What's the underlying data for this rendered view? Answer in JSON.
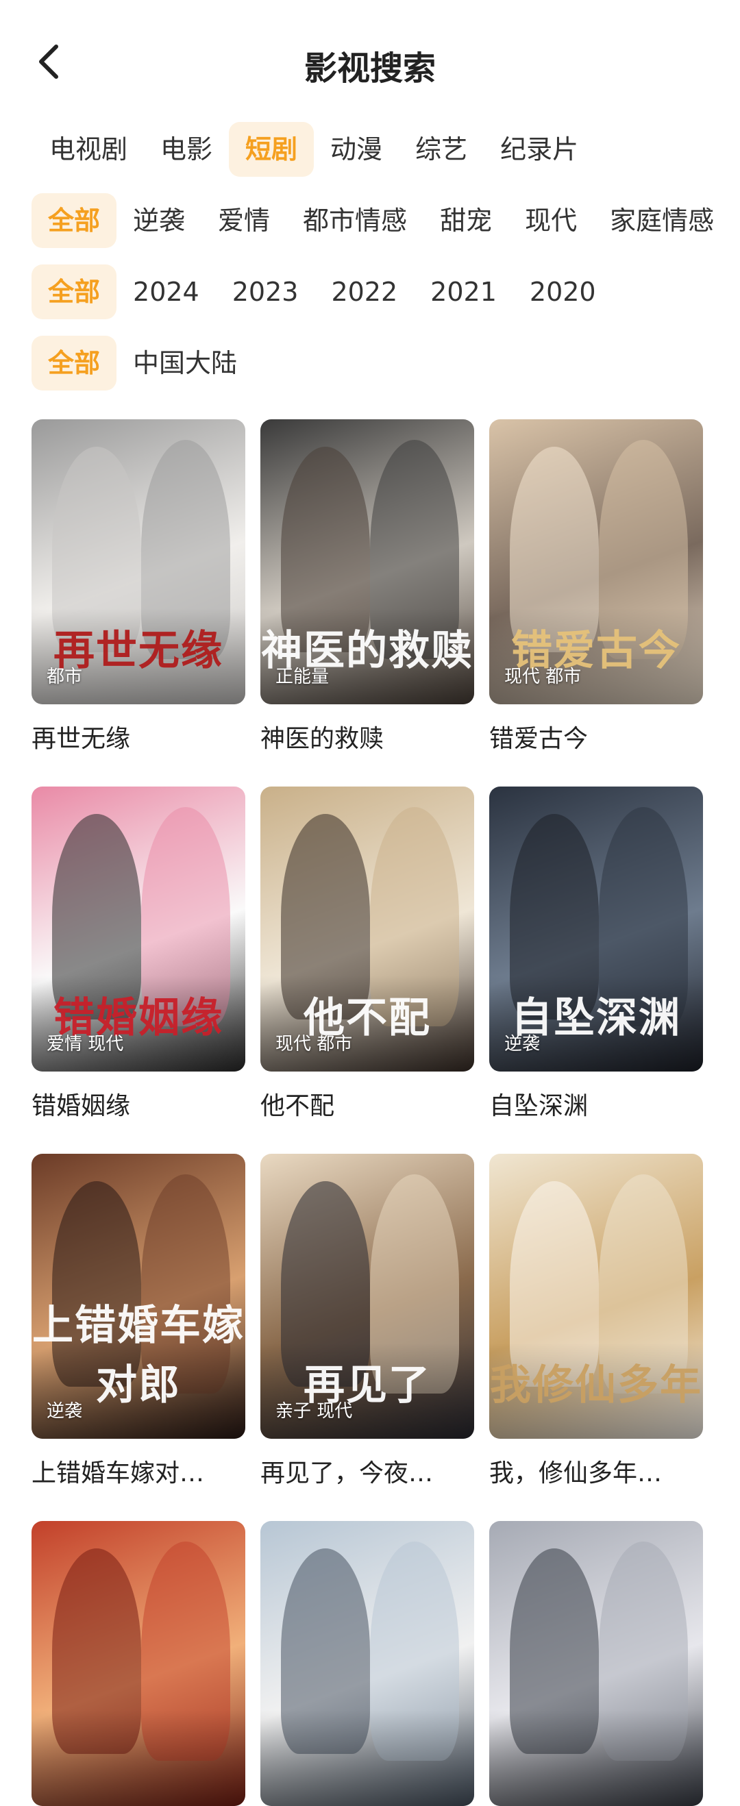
{
  "header": {
    "title": "影视搜索"
  },
  "filters": {
    "types": [
      "电视剧",
      "电影",
      "短剧",
      "动漫",
      "综艺",
      "纪录片"
    ],
    "genres": [
      "全部",
      "逆袭",
      "爱情",
      "都市情感",
      "甜宠",
      "现代",
      "家庭情感"
    ],
    "years": [
      "全部",
      "2024",
      "2023",
      "2022",
      "2021",
      "2020"
    ],
    "regions": [
      "全部",
      "中国大陆"
    ],
    "active_type": "短剧",
    "active_genre": "全部",
    "active_year": "全部",
    "active_region": "全部"
  },
  "items": [
    {
      "title": "再世无缘",
      "tag": "都市",
      "poster_art": "再世无缘",
      "colors": [
        "#9a9a9a",
        "#f1efec",
        "#c8c6c4"
      ],
      "art_color": "#b01d1d"
    },
    {
      "title": "神医的救赎",
      "tag": "正能量",
      "poster_art": "神医的救赎",
      "colors": [
        "#3a3a3a",
        "#cfc9c0",
        "#4a4038"
      ],
      "art_color": "#ffffff"
    },
    {
      "title": "错爱古今",
      "tag": "现代 都市",
      "poster_art": "错爱古今",
      "colors": [
        "#d9c3a8",
        "#7a6a5e",
        "#f3e4d0"
      ],
      "art_color": "#e6c27a"
    },
    {
      "title": "错婚姻缘",
      "tag": "爱情 现代",
      "poster_art": "错婚姻缘",
      "colors": [
        "#e98aa6",
        "#fafafa",
        "#2c2c2c"
      ],
      "art_color": "#c8202a"
    },
    {
      "title": "他不配",
      "tag": "现代 都市",
      "poster_art": "他不配",
      "colors": [
        "#c9b089",
        "#efe6d6",
        "#3b2f28"
      ],
      "art_color": "#ffffff"
    },
    {
      "title": "自坠深渊",
      "tag": "逆袭",
      "poster_art": "自坠深渊",
      "colors": [
        "#2b3340",
        "#6e7c8e",
        "#1d2028"
      ],
      "art_color": "#ffffff"
    },
    {
      "title": "上错婚车嫁对…",
      "tag": "逆袭",
      "poster_art": "上错婚车嫁对郎",
      "colors": [
        "#6b3b27",
        "#d8a070",
        "#2a1a16"
      ],
      "art_color": "#ffffff"
    },
    {
      "title": "再见了，今夜…",
      "tag": "亲子 现代",
      "poster_art": "再见了",
      "colors": [
        "#e9d9c2",
        "#8a6a4c",
        "#2a2a32"
      ],
      "art_color": "#ffffff"
    },
    {
      "title": "我，修仙多年…",
      "tag": "",
      "poster_art": "我修仙多年",
      "colors": [
        "#f0e6d2",
        "#c9a062",
        "#fbf6ee"
      ],
      "art_color": "#c9a062"
    },
    {
      "title": "",
      "tag": "",
      "poster_art": "",
      "colors": [
        "#c2402a",
        "#f1b07a",
        "#7a1f14"
      ],
      "art_color": "#ffffff"
    },
    {
      "title": "",
      "tag": "",
      "poster_art": "",
      "colors": [
        "#b7c6d4",
        "#f1f1f1",
        "#4a5664"
      ],
      "art_color": "#ffffff"
    },
    {
      "title": "",
      "tag": "",
      "poster_art": "",
      "colors": [
        "#a6aab4",
        "#e7e7ec",
        "#3b3f48"
      ],
      "art_color": "#ffffff"
    }
  ]
}
